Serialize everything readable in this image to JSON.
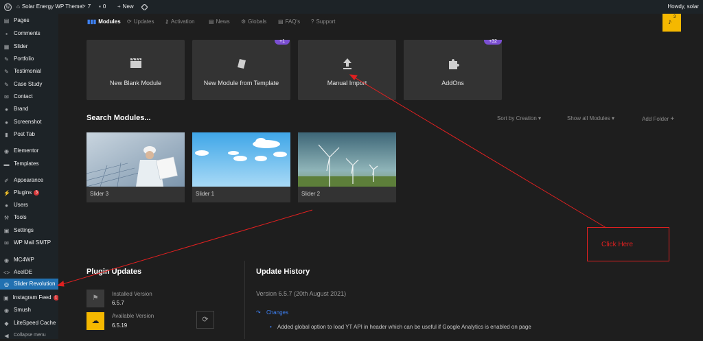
{
  "topbar": {
    "site_name": "Solar Energy WP Theme",
    "updates_count": "7",
    "comments_count": "0",
    "new_label": "New",
    "greeting": "Howdy, solar",
    "notification_count": "3"
  },
  "sidebar": {
    "items": [
      {
        "label": "Pages",
        "icon": "pages-icon"
      },
      {
        "label": "Comments",
        "icon": "comments-icon"
      },
      {
        "label": "Slider",
        "icon": "slider-icon"
      },
      {
        "label": "Portfolio",
        "icon": "portfolio-icon"
      },
      {
        "label": "Testimonial",
        "icon": "testimonial-icon"
      },
      {
        "label": "Case Study",
        "icon": "case-study-icon"
      },
      {
        "label": "Contact",
        "icon": "contact-icon"
      },
      {
        "label": "Brand",
        "icon": "brand-icon"
      },
      {
        "label": "Screenshot",
        "icon": "screenshot-icon"
      },
      {
        "label": "Post Tab",
        "icon": "post-tab-icon"
      },
      {
        "label": "Elementor",
        "icon": "elementor-icon"
      },
      {
        "label": "Templates",
        "icon": "templates-icon"
      },
      {
        "label": "Appearance",
        "icon": "appearance-icon"
      },
      {
        "label": "Plugins",
        "icon": "plugins-icon",
        "badge": "3"
      },
      {
        "label": "Users",
        "icon": "users-icon"
      },
      {
        "label": "Tools",
        "icon": "tools-icon"
      },
      {
        "label": "Settings",
        "icon": "settings-icon"
      },
      {
        "label": "WP Mail SMTP",
        "icon": "mail-icon"
      },
      {
        "label": "MC4WP",
        "icon": "mc4wp-icon"
      },
      {
        "label": "AceIDE",
        "icon": "code-icon"
      },
      {
        "label": "Slider Revolution",
        "icon": "revolution-icon"
      },
      {
        "label": "Instagram Feed",
        "icon": "instagram-icon",
        "badge": "1"
      },
      {
        "label": "Smush",
        "icon": "smush-icon"
      },
      {
        "label": "LiteSpeed Cache",
        "icon": "litespeed-icon"
      },
      {
        "label": "Collapse menu",
        "icon": "collapse-icon"
      }
    ]
  },
  "nav": {
    "modules": "Modules",
    "updates": "Updates",
    "activation": "Activation",
    "news": "News",
    "globals": "Globals",
    "faqs": "FAQ's",
    "support": "Support"
  },
  "cards": {
    "new_blank": "New Blank Module",
    "from_template": "New Module from Template",
    "manual_import": "Manual Import",
    "addons": "AddOns",
    "template_count": "+1",
    "addons_count": "+32"
  },
  "modules_section": {
    "search": "Search Modules...",
    "sort": "Sort by Creation",
    "show": "Show all Modules",
    "add_folder": "Add Folder"
  },
  "sliders": [
    {
      "name": "Slider 3"
    },
    {
      "name": "Slider 1"
    },
    {
      "name": "Slider 2"
    }
  ],
  "annotation": {
    "text": "Click Here"
  },
  "plugin_updates": {
    "title": "Plugin Updates",
    "installed_label": "Installed Version",
    "installed_value": "6.5.7",
    "available_label": "Available Version",
    "available_value": "6.5.19"
  },
  "update_history": {
    "title": "Update History",
    "version": "Version 6.5.7 (20th August 2021)",
    "changes": "Changes",
    "item": "Added global option to load YT API in header which can be useful if Google Analytics is enabled on page"
  },
  "colors": {
    "accent_blue": "#2271b1",
    "notification_yellow": "#f5b800",
    "annotation_red": "#e02020",
    "pill_purple": "#7b4fd2"
  }
}
